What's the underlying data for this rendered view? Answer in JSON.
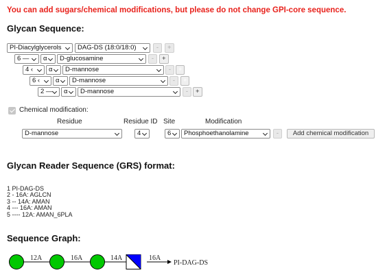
{
  "warning": "You can add sugars/chemical modifications, but please do not change GPI-core sequence.",
  "glycan_sequence": {
    "heading": "Glycan Sequence:",
    "rows": [
      {
        "selects": [
          "PI-Diacylglycerols",
          "DAG-DS (18:0/18:0)"
        ],
        "buttons": [
          "-",
          "+"
        ]
      },
      {
        "selects": [
          "6 —",
          "α",
          "D-glucosamine"
        ],
        "buttons": [
          "-",
          "+"
        ]
      },
      {
        "selects": [
          "4 ‹",
          "α",
          "D-mannose"
        ],
        "buttons": [
          "-",
          "+"
        ]
      },
      {
        "selects": [
          "6 ‹",
          "α",
          "D-mannose"
        ],
        "buttons": [
          "-",
          "+"
        ]
      },
      {
        "selects": [
          "2 —",
          "α",
          "D-mannose"
        ],
        "buttons": [
          "-",
          "+"
        ]
      }
    ]
  },
  "chemical_modification": {
    "checkbox_label": "Chemical modification:",
    "checked": true,
    "headers": {
      "residue": "Residue",
      "residue_id": "Residue ID",
      "site": "Site",
      "modification": "Modification"
    },
    "residue": "D-mannose",
    "residue_id": "4",
    "site": "6",
    "modification": "Phosphoethanolamine",
    "minus_button": "-",
    "add_button": "Add chemical modification"
  },
  "grs": {
    "heading": "Glycan Reader Sequence (GRS) format:",
    "lines": [
      "1 PI-DAG-DS",
      "2 - 16A: AGLCN",
      "3 -- 14A: AMAN",
      "4 --- 16A: AMAN",
      "5 ---- 12A: AMAN_6PLA"
    ]
  },
  "graph": {
    "heading": "Sequence Graph:",
    "edge_labels": [
      "12A",
      "16A",
      "14A",
      "16A"
    ],
    "terminal_label": "PI-DAG-DS",
    "colors": {
      "mannose": "#00c800",
      "glcnac_fill": "#0000ff",
      "outline": "#000000"
    }
  }
}
